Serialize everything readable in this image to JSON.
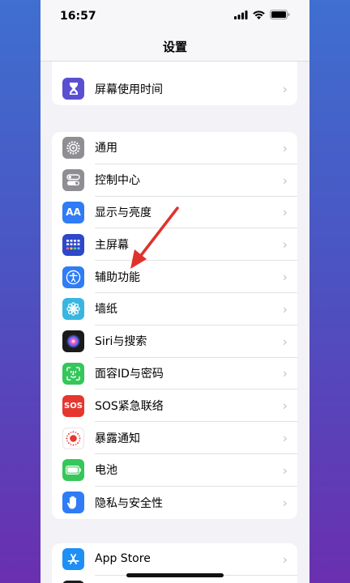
{
  "status": {
    "time": "16:57"
  },
  "nav": {
    "title": "设置"
  },
  "group1": [
    {
      "label": "屏幕使用时间",
      "icon": "hourglass-icon",
      "color": "#5b4fd0"
    }
  ],
  "group2": [
    {
      "label": "通用",
      "icon": "gear-icon",
      "color": "#8e8e93"
    },
    {
      "label": "控制中心",
      "icon": "toggles-icon",
      "color": "#8e8e93"
    },
    {
      "label": "显示与亮度",
      "icon": "display-aa-icon",
      "color": "#2f7cf6"
    },
    {
      "label": "主屏幕",
      "icon": "home-grid-icon",
      "color": "#2f47c9"
    },
    {
      "label": "辅助功能",
      "icon": "accessibility-icon",
      "color": "#2f7cf6"
    },
    {
      "label": "墙纸",
      "icon": "flower-icon",
      "color": "#38b6e0"
    },
    {
      "label": "Siri与搜索",
      "icon": "siri-icon",
      "color": "#222222"
    },
    {
      "label": "面容ID与密码",
      "icon": "faceid-icon",
      "color": "#34c759"
    },
    {
      "label": "SOS紧急联络",
      "icon": "sos-icon",
      "color": "#e5372f"
    },
    {
      "label": "暴露通知",
      "icon": "exposure-icon",
      "color": "#ffffff"
    },
    {
      "label": "电池",
      "icon": "battery-icon",
      "color": "#34c759"
    },
    {
      "label": "隐私与安全性",
      "icon": "hand-icon",
      "color": "#2f7cf6"
    }
  ],
  "group3": [
    {
      "label": "App Store",
      "icon": "appstore-icon",
      "color": "#1e8ff5"
    }
  ],
  "annotation": {
    "color": "#e0322d"
  }
}
